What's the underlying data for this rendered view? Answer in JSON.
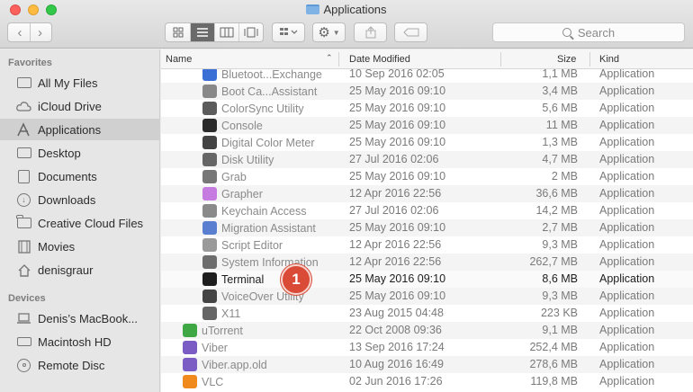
{
  "window": {
    "title": "Applications"
  },
  "toolbar": {
    "back": "‹",
    "forward": "›",
    "search_placeholder": "Search"
  },
  "sidebar": {
    "favorites_label": "Favorites",
    "devices_label": "Devices",
    "favorites": [
      {
        "label": "All My Files",
        "icon": "all-files-icon"
      },
      {
        "label": "iCloud Drive",
        "icon": "cloud-icon"
      },
      {
        "label": "Applications",
        "icon": "applications-icon",
        "active": true
      },
      {
        "label": "Desktop",
        "icon": "desktop-icon"
      },
      {
        "label": "Documents",
        "icon": "documents-icon"
      },
      {
        "label": "Downloads",
        "icon": "downloads-icon"
      },
      {
        "label": "Creative Cloud Files",
        "icon": "folder-icon"
      },
      {
        "label": "Movies",
        "icon": "movies-icon"
      },
      {
        "label": "denisgraur",
        "icon": "home-icon"
      }
    ],
    "devices": [
      {
        "label": "Denis’s MacBook...",
        "icon": "laptop-icon"
      },
      {
        "label": "Macintosh HD",
        "icon": "disk-icon"
      },
      {
        "label": "Remote Disc",
        "icon": "disc-icon"
      }
    ]
  },
  "columns": {
    "name": "Name",
    "date": "Date Modified",
    "size": "Size",
    "kind": "Kind"
  },
  "files": [
    {
      "name": "Bluetoot...Exchange",
      "date": "10 Sep 2016 02:05",
      "size": "1,1 MB",
      "kind": "Application",
      "indent": 1,
      "color": "#3b6fd6"
    },
    {
      "name": "Boot Ca...Assistant",
      "date": "25 May 2016 09:10",
      "size": "3,4 MB",
      "kind": "Application",
      "indent": 1,
      "color": "#888888"
    },
    {
      "name": "ColorSync Utility",
      "date": "25 May 2016 09:10",
      "size": "5,6 MB",
      "kind": "Application",
      "indent": 1,
      "color": "#5c5c5c"
    },
    {
      "name": "Console",
      "date": "25 May 2016 09:10",
      "size": "11 MB",
      "kind": "Application",
      "indent": 1,
      "color": "#2b2b2b"
    },
    {
      "name": "Digital Color Meter",
      "date": "25 May 2016 09:10",
      "size": "1,3 MB",
      "kind": "Application",
      "indent": 1,
      "color": "#444444"
    },
    {
      "name": "Disk Utility",
      "date": "27 Jul 2016 02:06",
      "size": "4,7 MB",
      "kind": "Application",
      "indent": 1,
      "color": "#666666"
    },
    {
      "name": "Grab",
      "date": "25 May 2016 09:10",
      "size": "2 MB",
      "kind": "Application",
      "indent": 1,
      "color": "#777777"
    },
    {
      "name": "Grapher",
      "date": "12 Apr 2016 22:56",
      "size": "36,6 MB",
      "kind": "Application",
      "indent": 1,
      "color": "#c67be0"
    },
    {
      "name": "Keychain Access",
      "date": "27 Jul 2016 02:06",
      "size": "14,2 MB",
      "kind": "Application",
      "indent": 1,
      "color": "#8a8a8a"
    },
    {
      "name": "Migration Assistant",
      "date": "25 May 2016 09:10",
      "size": "2,7 MB",
      "kind": "Application",
      "indent": 1,
      "color": "#5a7fd1"
    },
    {
      "name": "Script Editor",
      "date": "12 Apr 2016 22:56",
      "size": "9,3 MB",
      "kind": "Application",
      "indent": 1,
      "color": "#9a9a9a"
    },
    {
      "name": "System Information",
      "date": "12 Apr 2016 22:56",
      "size": "262,7 MB",
      "kind": "Application",
      "indent": 1,
      "color": "#6d6d6d"
    },
    {
      "name": "Terminal",
      "date": "25 May 2016 09:10",
      "size": "8,6 MB",
      "kind": "Application",
      "indent": 1,
      "color": "#1e1e1e",
      "selected": true
    },
    {
      "name": "VoiceOver Utility",
      "date": "25 May 2016 09:10",
      "size": "9,3 MB",
      "kind": "Application",
      "indent": 1,
      "color": "#444444"
    },
    {
      "name": "X11",
      "date": "23 Aug 2015 04:48",
      "size": "223 KB",
      "kind": "Application",
      "indent": 1,
      "color": "#666666"
    },
    {
      "name": "uTorrent",
      "date": "22 Oct 2008 09:36",
      "size": "9,1 MB",
      "kind": "Application",
      "indent": 0,
      "color": "#3fa845"
    },
    {
      "name": "Viber",
      "date": "13 Sep 2016 17:24",
      "size": "252,4 MB",
      "kind": "Application",
      "indent": 0,
      "color": "#7b5bc4"
    },
    {
      "name": "Viber.app.old",
      "date": "10 Aug 2016 16:49",
      "size": "278,6 MB",
      "kind": "Application",
      "indent": 0,
      "color": "#7b5bc4"
    },
    {
      "name": "VLC",
      "date": "02 Jun 2016 17:26",
      "size": "119,8 MB",
      "kind": "Application",
      "indent": 0,
      "color": "#f08a1c"
    }
  ],
  "annotation": {
    "label": "1",
    "color": "#d94a37"
  }
}
